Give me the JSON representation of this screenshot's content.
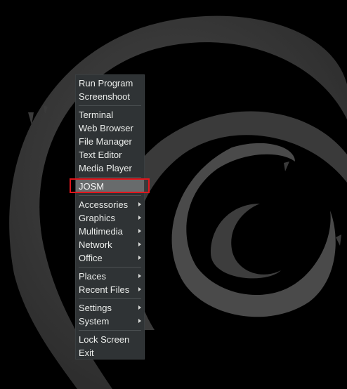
{
  "menu": {
    "items": [
      {
        "label": "Run Program"
      },
      {
        "label": "Screenshoot"
      },
      {
        "label": "Terminal"
      },
      {
        "label": "Web Browser"
      },
      {
        "label": "File Manager"
      },
      {
        "label": "Text Editor"
      },
      {
        "label": "Media Player"
      },
      {
        "label": "JOSM",
        "selected": true
      },
      {
        "label": "Accessories",
        "submenu": true
      },
      {
        "label": "Graphics",
        "submenu": true
      },
      {
        "label": "Multimedia",
        "submenu": true
      },
      {
        "label": "Network",
        "submenu": true
      },
      {
        "label": "Office",
        "submenu": true
      },
      {
        "label": "Places",
        "submenu": true
      },
      {
        "label": "Recent Files",
        "submenu": true
      },
      {
        "label": "Settings",
        "submenu": true
      },
      {
        "label": "System",
        "submenu": true
      },
      {
        "label": "Lock Screen"
      },
      {
        "label": "Exit"
      }
    ]
  },
  "colors": {
    "desktop_background": "#000000",
    "swirl": "#3c3c3c",
    "menu_background": "#2f3335",
    "selected_item_background": "#686b6c",
    "highlight_box": "#e0161c"
  }
}
